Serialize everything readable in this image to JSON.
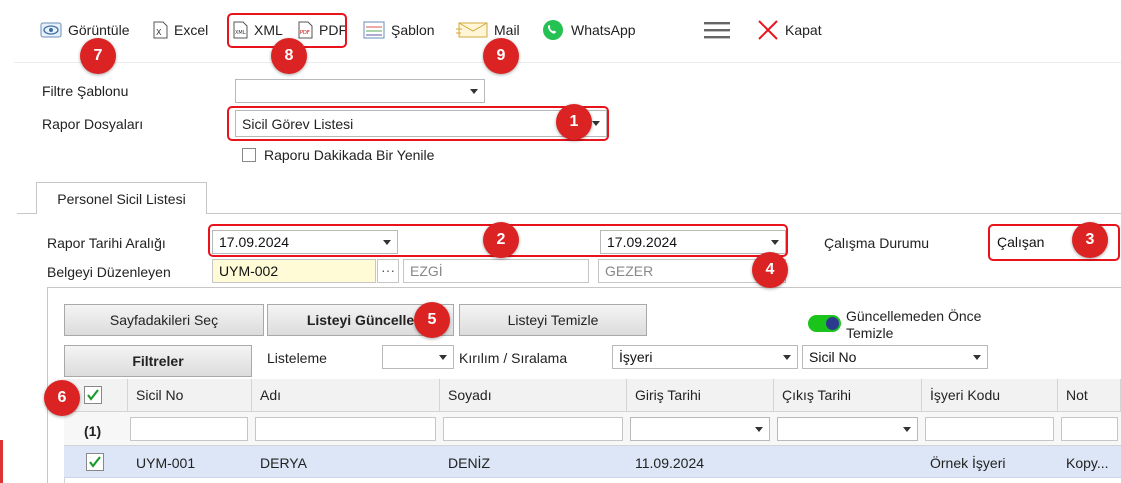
{
  "toolbar": {
    "view_label": "Görüntüle",
    "excel_label": "Excel",
    "xml_label": "XML",
    "pdf_label": "PDF",
    "template_label": "Şablon",
    "mail_label": "Mail",
    "whatsapp_label": "WhatsApp",
    "close_label": "Kapat"
  },
  "badges": [
    "7",
    "8",
    "9",
    "1",
    "2",
    "3",
    "4",
    "5",
    "6"
  ],
  "form": {
    "filter_template_label": "Filtre Şablonu",
    "filter_template_value": "",
    "report_files_label": "Rapor Dosyaları",
    "report_files_value": "Sicil Görev Listesi",
    "refresh_label": "Raporu Dakikada Bir Yenile"
  },
  "tab": {
    "label": "Personel Sicil Listesi"
  },
  "report": {
    "date_range_label": "Rapor Tarihi Aralığı",
    "date_start": "17.09.2024",
    "date_end": "17.09.2024",
    "status_label": "Çalışma Durumu",
    "status_value": "Çalışan",
    "issuer_label": "Belgeyi Düzenleyen",
    "issuer_code": "UYM-002",
    "issuer_more": "···",
    "issuer_name": "EZGİ",
    "issuer_surname": "GEZER"
  },
  "actions": {
    "select_page": "Sayfadakileri Seç",
    "update_list": "Listeyi Güncelle",
    "clear_list": "Listeyi Temizle",
    "clear_before_update": "Güncellemeden Önce Temizle",
    "filters": "Filtreler",
    "listing_label": "Listeleme",
    "listing_value": "",
    "grouping_label": "Kırılım / Sıralama",
    "grouping_value": "İşyeri",
    "sort_value": "Sicil No"
  },
  "grid": {
    "columns": [
      "Sicil No",
      "Adı",
      "Soyadı",
      "Giriş Tarihi",
      "Çıkış Tarihi",
      "İşyeri Kodu",
      "Not"
    ],
    "group_count": "(1)",
    "rows": [
      {
        "sicil_no": "UYM-001",
        "adi": "DERYA",
        "soyadi": "DENİZ",
        "giris": "11.09.2024",
        "cikis": "",
        "isyeri": "Örnek İşyeri",
        "not": "Kopy..."
      }
    ]
  },
  "colors": {
    "accent_red": "#e8131b",
    "badge_red": "#dc2323",
    "row_selected": "#dce6f6",
    "highlight_yellow": "#fffbd6",
    "toggle_green": "#1bc41b"
  }
}
